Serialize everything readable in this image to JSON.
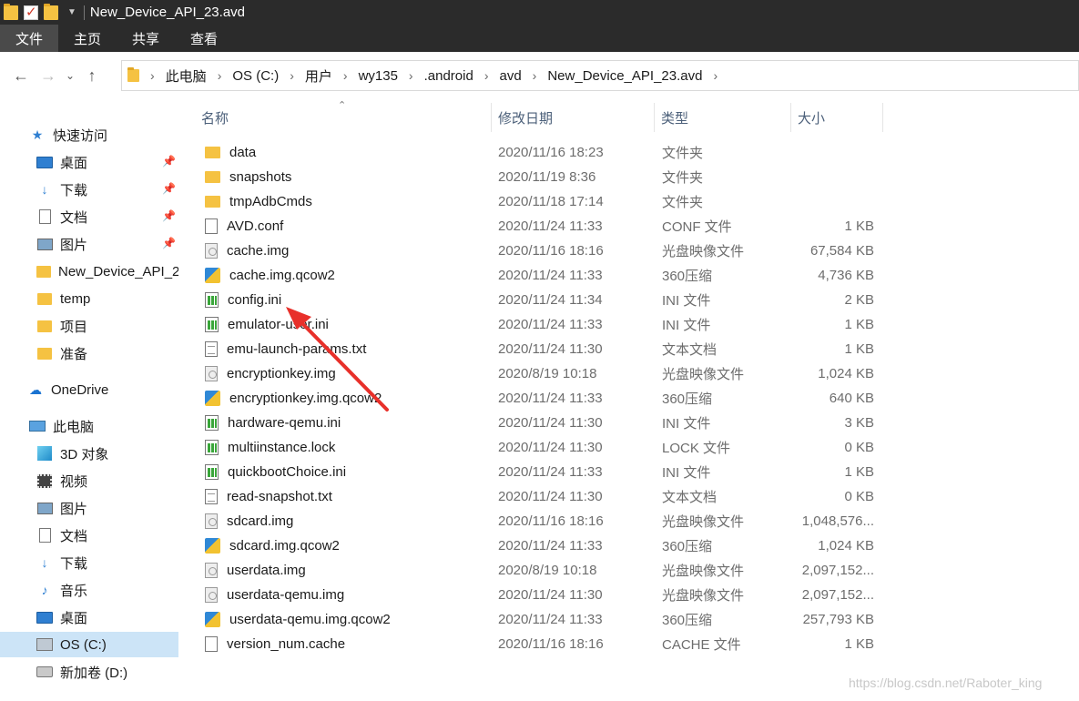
{
  "window": {
    "title": "New_Device_API_23.avd"
  },
  "ribbon": {
    "tabs": [
      "文件",
      "主页",
      "共享",
      "查看"
    ]
  },
  "address": {
    "crumbs": [
      "此电脑",
      "OS (C:)",
      "用户",
      "wy135",
      ".android",
      "avd",
      "New_Device_API_23.avd"
    ]
  },
  "sidebar": {
    "items": [
      {
        "label": "快速访问",
        "icon": "star-icon"
      },
      {
        "label": "桌面",
        "icon": "desktop-icon",
        "pinned": true
      },
      {
        "label": "下载",
        "icon": "download-icon",
        "pinned": true
      },
      {
        "label": "文档",
        "icon": "document-icon",
        "pinned": true
      },
      {
        "label": "图片",
        "icon": "picture-icon",
        "pinned": true
      },
      {
        "label": "New_Device_API_2",
        "icon": "folder-icon"
      },
      {
        "label": "temp",
        "icon": "folder-icon"
      },
      {
        "label": "项目",
        "icon": "folder-icon"
      },
      {
        "label": "准备",
        "icon": "folder-icon"
      },
      {
        "label": "OneDrive",
        "icon": "cloud-icon"
      },
      {
        "label": "此电脑",
        "icon": "pc-icon"
      },
      {
        "label": "3D 对象",
        "icon": "3d-objects-icon"
      },
      {
        "label": "视频",
        "icon": "video-icon"
      },
      {
        "label": "图片",
        "icon": "picture-icon"
      },
      {
        "label": "文档",
        "icon": "document-icon"
      },
      {
        "label": "下载",
        "icon": "download-icon"
      },
      {
        "label": "音乐",
        "icon": "music-icon"
      },
      {
        "label": "桌面",
        "icon": "desktop-icon"
      },
      {
        "label": "OS (C:)",
        "icon": "os-drive-icon",
        "selected": true
      },
      {
        "label": "新加卷 (D:)",
        "icon": "drive-icon"
      }
    ]
  },
  "columns": {
    "name": "名称",
    "date": "修改日期",
    "type": "类型",
    "size": "大小"
  },
  "files": [
    {
      "name": "data",
      "date": "2020/11/16 18:23",
      "type": "文件夹",
      "size": "",
      "icon": "folder-icon"
    },
    {
      "name": "snapshots",
      "date": "2020/11/19 8:36",
      "type": "文件夹",
      "size": "",
      "icon": "folder-icon"
    },
    {
      "name": "tmpAdbCmds",
      "date": "2020/11/18 17:14",
      "type": "文件夹",
      "size": "",
      "icon": "folder-icon"
    },
    {
      "name": "AVD.conf",
      "date": "2020/11/24 11:33",
      "type": "CONF 文件",
      "size": "1 KB",
      "icon": "file-icon"
    },
    {
      "name": "cache.img",
      "date": "2020/11/16 18:16",
      "type": "光盘映像文件",
      "size": "67,584 KB",
      "icon": "disc-image-icon"
    },
    {
      "name": "cache.img.qcow2",
      "date": "2020/11/24 11:33",
      "type": "360压缩",
      "size": "4,736 KB",
      "icon": "archive-icon"
    },
    {
      "name": "config.ini",
      "date": "2020/11/24 11:34",
      "type": "INI 文件",
      "size": "2 KB",
      "icon": "ini-file-icon"
    },
    {
      "name": "emulator-user.ini",
      "date": "2020/11/24 11:33",
      "type": "INI 文件",
      "size": "1 KB",
      "icon": "ini-file-icon"
    },
    {
      "name": "emu-launch-params.txt",
      "date": "2020/11/24 11:30",
      "type": "文本文档",
      "size": "1 KB",
      "icon": "text-file-icon"
    },
    {
      "name": "encryptionkey.img",
      "date": "2020/8/19 10:18",
      "type": "光盘映像文件",
      "size": "1,024 KB",
      "icon": "disc-image-icon"
    },
    {
      "name": "encryptionkey.img.qcow2",
      "date": "2020/11/24 11:33",
      "type": "360压缩",
      "size": "640 KB",
      "icon": "archive-icon"
    },
    {
      "name": "hardware-qemu.ini",
      "date": "2020/11/24 11:30",
      "type": "INI 文件",
      "size": "3 KB",
      "icon": "ini-file-icon"
    },
    {
      "name": "multiinstance.lock",
      "date": "2020/11/24 11:30",
      "type": "LOCK 文件",
      "size": "0 KB",
      "icon": "ini-file-icon"
    },
    {
      "name": "quickbootChoice.ini",
      "date": "2020/11/24 11:33",
      "type": "INI 文件",
      "size": "1 KB",
      "icon": "ini-file-icon"
    },
    {
      "name": "read-snapshot.txt",
      "date": "2020/11/24 11:30",
      "type": "文本文档",
      "size": "0 KB",
      "icon": "text-file-icon"
    },
    {
      "name": "sdcard.img",
      "date": "2020/11/16 18:16",
      "type": "光盘映像文件",
      "size": "1,048,576...",
      "icon": "disc-image-icon"
    },
    {
      "name": "sdcard.img.qcow2",
      "date": "2020/11/24 11:33",
      "type": "360压缩",
      "size": "1,024 KB",
      "icon": "archive-icon"
    },
    {
      "name": "userdata.img",
      "date": "2020/8/19 10:18",
      "type": "光盘映像文件",
      "size": "2,097,152...",
      "icon": "disc-image-icon"
    },
    {
      "name": "userdata-qemu.img",
      "date": "2020/11/24 11:30",
      "type": "光盘映像文件",
      "size": "2,097,152...",
      "icon": "disc-image-icon"
    },
    {
      "name": "userdata-qemu.img.qcow2",
      "date": "2020/11/24 11:33",
      "type": "360压缩",
      "size": "257,793 KB",
      "icon": "archive-icon"
    },
    {
      "name": "version_num.cache",
      "date": "2020/11/16 18:16",
      "type": "CACHE 文件",
      "size": "1 KB",
      "icon": "file-icon"
    }
  ],
  "annotation": {
    "arrow_color": "#e8302a"
  },
  "watermark": "https://blog.csdn.net/Raboter_king"
}
